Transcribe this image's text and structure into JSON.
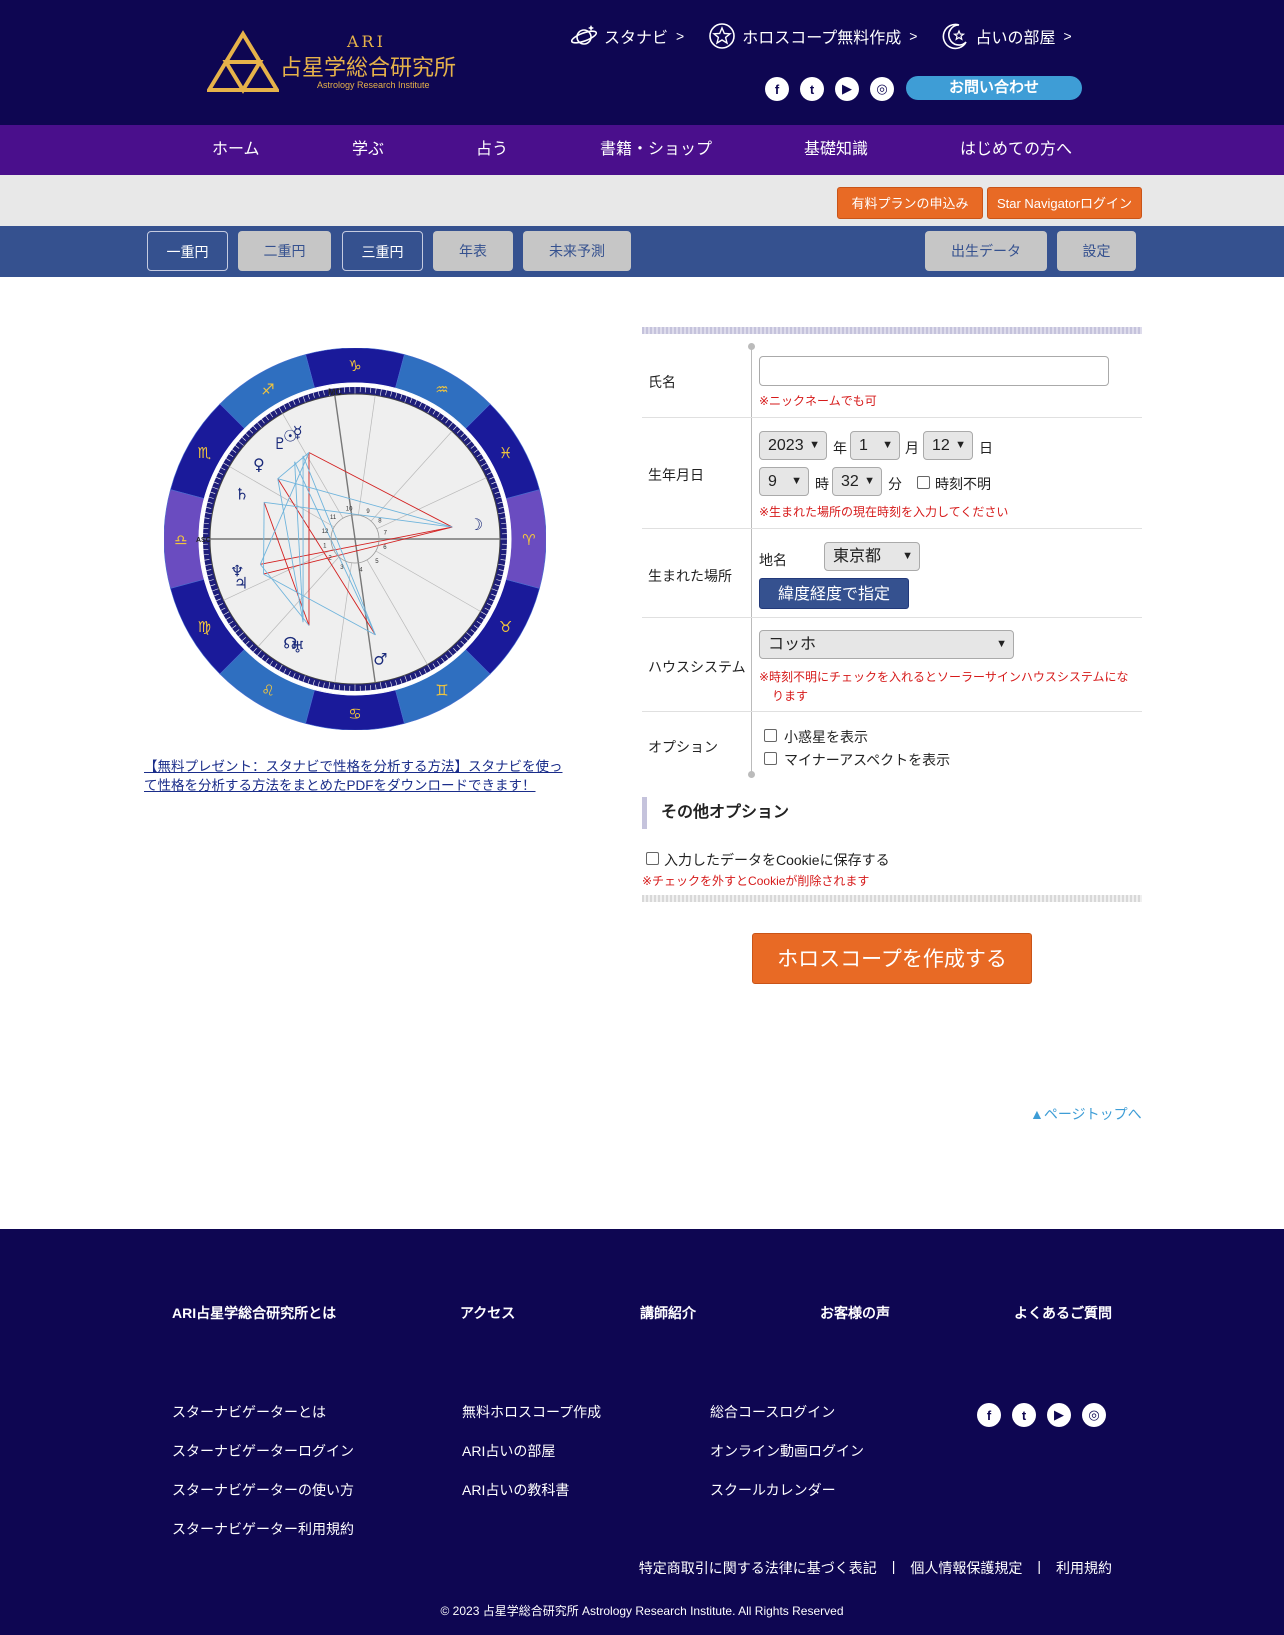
{
  "header": {
    "logo_ari": "ARI",
    "logo_jp": "占星学総合研究所",
    "logo_en": "Astrology Research Institute",
    "top_links": [
      {
        "label": "スタナビ",
        "icon": "saturn-icon"
      },
      {
        "label": "ホロスコープ無料作成",
        "icon": "star-circle-icon"
      },
      {
        "label": "占いの部屋",
        "icon": "moon-star-icon"
      }
    ],
    "social": [
      "f",
      "t",
      "▶",
      "◎"
    ],
    "contact": "お問い合わせ"
  },
  "nav": [
    "ホーム",
    "学ぶ",
    "占う",
    "書籍・ショップ",
    "基礎知識",
    "はじめての方へ"
  ],
  "subbar": {
    "paid_plan": "有料プランの申込み",
    "login": "Star Navigatorログイン"
  },
  "tabs": {
    "single": "一重円",
    "double": "二重円",
    "triple": "三重円",
    "chronology": "年表",
    "forecast": "未来予測",
    "birth_data": "出生データ",
    "settings": "設定"
  },
  "chart": {
    "signs": [
      "♑",
      "♐",
      "♏",
      "♎",
      "♍",
      "♌",
      "♋",
      "♊",
      "♉",
      "♈",
      "♓",
      "♒"
    ],
    "mc_label": "MC",
    "asc_label": "ASC",
    "houses": [
      "1",
      "2",
      "3",
      "4",
      "5",
      "6",
      "7",
      "8",
      "9",
      "10",
      "11",
      "12"
    ]
  },
  "promo_text": "【無料プレゼント：スタナビで性格を分析する方法】スタナビを使って性格を分析する方法をまとめたPDFをダウンロードできます！",
  "form": {
    "name_label": "氏名",
    "name_value": "",
    "name_note": "※ニックネームでも可",
    "birthdate_label": "生年月日",
    "year": "2023",
    "year_unit": "年",
    "month": "1",
    "month_unit": "月",
    "day": "12",
    "day_unit": "日",
    "hour": "9",
    "hour_unit": "時",
    "minute": "32",
    "minute_unit": "分",
    "time_unknown": "時刻不明",
    "time_note": "※生まれた場所の現在時刻を入力してください",
    "place_label": "生まれた場所",
    "place_sub": "地名",
    "place_value": "東京都",
    "latlng_button": "緯度経度で指定",
    "house_label": "ハウスシステム",
    "house_value": "コッホ",
    "house_note_1": "※時刻不明にチェックを入れるとソーラーサインハウスシステムにな",
    "house_note_2": "ります",
    "option_label": "オプション",
    "opt_asteroids": "小惑星を表示",
    "opt_minor": "マイナーアスペクトを表示",
    "other_title": "その他オプション",
    "cookie_label": "入力したデータをCookieに保存する",
    "cookie_note": "※チェックを外すとCookieが削除されます",
    "submit": "ホロスコープを作成する"
  },
  "page_top": "▲ページトップへ",
  "footer": {
    "heads": [
      "ARI占星学総合研究所とは",
      "アクセス",
      "講師紹介",
      "お客様の声",
      "よくあるご質問"
    ],
    "col1": [
      "スターナビゲーターとは",
      "スターナビゲーターログイン",
      "スターナビゲーターの使い方",
      "スターナビゲーター利用規約"
    ],
    "col2": [
      "無料ホロスコープ作成",
      "ARI占いの部屋",
      "ARI占いの教科書"
    ],
    "col3": [
      "総合コースログイン",
      "オンライン動画ログイン",
      "スクールカレンダー"
    ],
    "legal": [
      "特定商取引に関する法律に基づく表記",
      "個人情報保護規定",
      "利用規約"
    ],
    "separator": "|",
    "copyright": "© 2023 占星学総合研究所 Astrology Research Institute. All Rights Reserved"
  }
}
